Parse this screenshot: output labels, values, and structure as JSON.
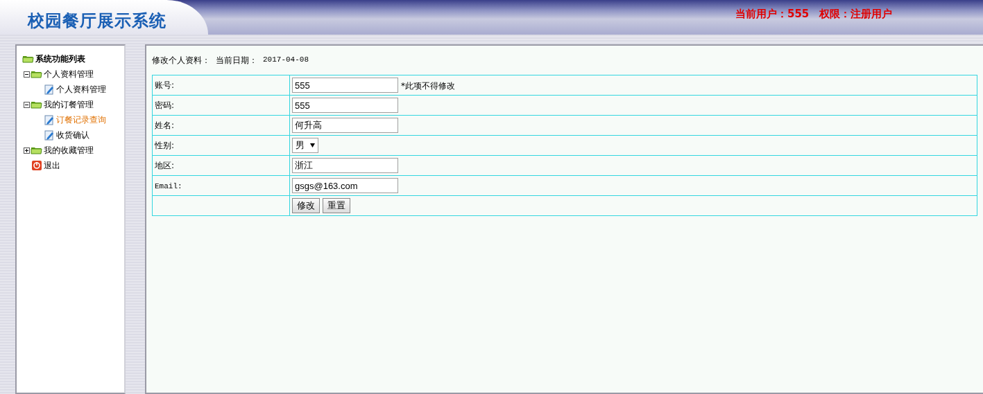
{
  "header": {
    "title": "校园餐厅展示系统",
    "user_info": "当前用户：555　权限：注册用户"
  },
  "sidebar": {
    "title": "系统功能列表",
    "items": [
      {
        "kind": "folder",
        "label": "个人资料管理",
        "expanded": true,
        "children": [
          {
            "label": "个人资料管理",
            "selected": false
          }
        ]
      },
      {
        "kind": "folder",
        "label": "我的订餐管理",
        "expanded": true,
        "children": [
          {
            "label": "订餐记录查询",
            "selected": true
          },
          {
            "label": "收货确认",
            "selected": false
          }
        ]
      },
      {
        "kind": "folder",
        "label": "我的收藏管理",
        "expanded": false
      },
      {
        "kind": "exit",
        "label": "退出"
      }
    ]
  },
  "content": {
    "heading": "修改个人资料：",
    "date_label": "当前日期：",
    "date": "2017-04-08",
    "rows": [
      {
        "kind": "text",
        "label": "账号:",
        "value": "555",
        "note": "*此项不得修改"
      },
      {
        "kind": "text",
        "label": "密码:",
        "value": "555"
      },
      {
        "kind": "text",
        "label": "姓名:",
        "value": "何升高"
      },
      {
        "kind": "select",
        "label": "性别:",
        "value": "男"
      },
      {
        "kind": "text",
        "label": "地区:",
        "value": "浙江"
      },
      {
        "kind": "text",
        "label": "Email:",
        "value": "gsgs@163.com"
      },
      {
        "kind": "buttons",
        "buttons": [
          "修改",
          "重置"
        ]
      }
    ]
  }
}
